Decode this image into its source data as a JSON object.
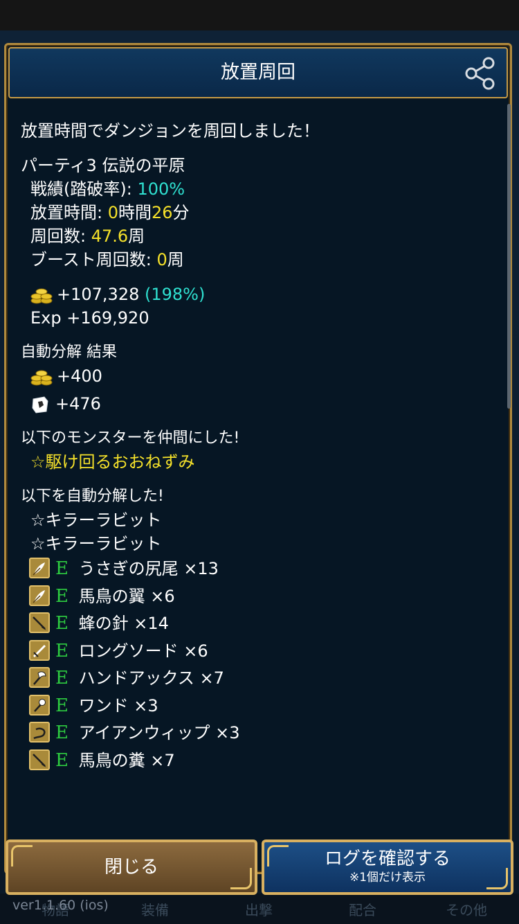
{
  "header": {
    "title": "放置周回"
  },
  "summary": {
    "intro": "放置時間でダンジョンを周回しました！",
    "party": "パーティ3 伝説の平原",
    "record_label": "戦績(踏破率): ",
    "record_value": "100%",
    "idle_label": "放置時間: ",
    "idle_hours": "0",
    "idle_hours_unit": "時間",
    "idle_minutes": "26",
    "idle_minutes_unit": "分",
    "laps_label": "周回数: ",
    "laps_value": "47.6",
    "laps_unit": "周",
    "boost_label": "ブースト周回数: ",
    "boost_value": "0",
    "boost_unit": "周"
  },
  "rewards": {
    "gold": "+107,328",
    "gold_bonus": "(198%)",
    "exp": "Exp +169,920"
  },
  "auto_decompose": {
    "title": "自動分解 結果",
    "gold": "+400",
    "material": "+476"
  },
  "recruited": {
    "title": "以下のモンスターを仲間にした!",
    "monsters": [
      "☆駆け回るおおねずみ"
    ]
  },
  "decomposed": {
    "title": "以下を自動分解した!",
    "monsters": [
      "☆キラーラビット",
      "☆キラーラビット"
    ],
    "items": [
      {
        "rank": "E",
        "name": "うさぎの尻尾 ×13",
        "icon": "feather-icon"
      },
      {
        "rank": "E",
        "name": "馬鳥の翼 ×6",
        "icon": "feather-icon"
      },
      {
        "rank": "E",
        "name": "蜂の針 ×14",
        "icon": "spear-icon"
      },
      {
        "rank": "E",
        "name": "ロングソード ×6",
        "icon": "sword-icon"
      },
      {
        "rank": "E",
        "name": "ハンドアックス ×7",
        "icon": "axe-icon"
      },
      {
        "rank": "E",
        "name": "ワンド ×3",
        "icon": "wand-icon"
      },
      {
        "rank": "E",
        "name": "アイアンウィップ ×3",
        "icon": "whip-icon"
      },
      {
        "rank": "E",
        "name": "馬鳥の糞 ×7",
        "icon": "spear-icon"
      }
    ]
  },
  "buttons": {
    "close": "閉じる",
    "view_log": "ログを確認する",
    "view_log_note": "※1個だけ表示"
  },
  "footer": {
    "version": "ver1.1.60 (ios)",
    "tabs": [
      "物語",
      "装備",
      "出撃",
      "配合",
      "その他"
    ]
  },
  "colors": {
    "accent_gold": "#c79a45",
    "highlight_yellow": "#f5e12a",
    "highlight_cyan": "#2fe0d0",
    "rank_green": "#2ecc40"
  }
}
